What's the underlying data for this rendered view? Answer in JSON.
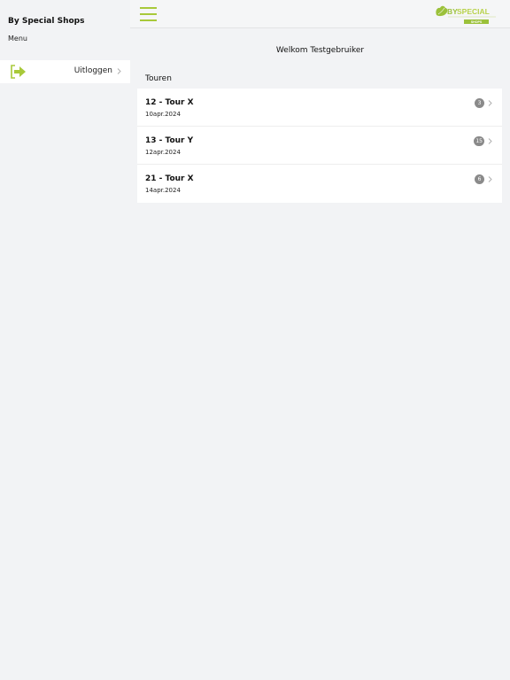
{
  "sidebar": {
    "title": "By Special Shops",
    "subtitle": "Menu",
    "items": [
      {
        "label": "Uitloggen",
        "icon": "logout-icon"
      }
    ]
  },
  "header": {
    "menu_icon": "hamburger-icon",
    "logo": {
      "text_by": "BY",
      "text_special": "SPECIAL",
      "text_shops": "SHOPS"
    }
  },
  "main": {
    "welcome": "Welkom Testgebruiker",
    "section_title": "Touren",
    "tours": [
      {
        "name": "12 - Tour X",
        "date": "10apr.2024",
        "badge": "3"
      },
      {
        "name": "13 - Tour Y",
        "date": "12apr.2024",
        "badge": "15"
      },
      {
        "name": "21 - Tour X",
        "date": "14apr.2024",
        "badge": "6"
      }
    ]
  },
  "colors": {
    "accent": "#a8c93a",
    "background": "#f2f3f5",
    "badge": "#8a8a8a"
  }
}
